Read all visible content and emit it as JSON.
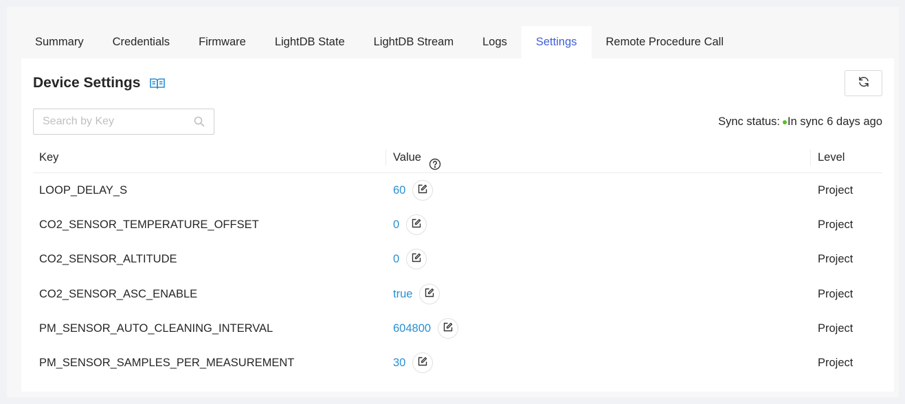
{
  "tabs": [
    {
      "label": "Summary",
      "active": false
    },
    {
      "label": "Credentials",
      "active": false
    },
    {
      "label": "Firmware",
      "active": false
    },
    {
      "label": "LightDB State",
      "active": false
    },
    {
      "label": "LightDB Stream",
      "active": false
    },
    {
      "label": "Logs",
      "active": false
    },
    {
      "label": "Settings",
      "active": true
    },
    {
      "label": "Remote Procedure Call",
      "active": false
    }
  ],
  "panel": {
    "title": "Device Settings",
    "search_placeholder": "Search by Key",
    "sync_label": "Sync status:",
    "sync_status": "In sync",
    "sync_time": "6 days ago"
  },
  "table": {
    "columns": {
      "key": "Key",
      "value": "Value",
      "level": "Level"
    },
    "rows": [
      {
        "key": "LOOP_DELAY_S",
        "value": "60",
        "level": "Project"
      },
      {
        "key": "CO2_SENSOR_TEMPERATURE_OFFSET",
        "value": "0",
        "level": "Project"
      },
      {
        "key": "CO2_SENSOR_ALTITUDE",
        "value": "0",
        "level": "Project"
      },
      {
        "key": "CO2_SENSOR_ASC_ENABLE",
        "value": "true",
        "level": "Project"
      },
      {
        "key": "PM_SENSOR_AUTO_CLEANING_INTERVAL",
        "value": "604800",
        "level": "Project"
      },
      {
        "key": "PM_SENSOR_SAMPLES_PER_MEASUREMENT",
        "value": "30",
        "level": "Project"
      }
    ]
  },
  "colors": {
    "accent": "#3f5fd8",
    "value_link": "#2a8fd0",
    "sync_ok": "#52c41a"
  },
  "icons": {
    "docs": "book-open-icon",
    "refresh": "refresh-icon",
    "search": "search-icon",
    "help": "question-circle-icon",
    "edit": "edit-icon"
  }
}
